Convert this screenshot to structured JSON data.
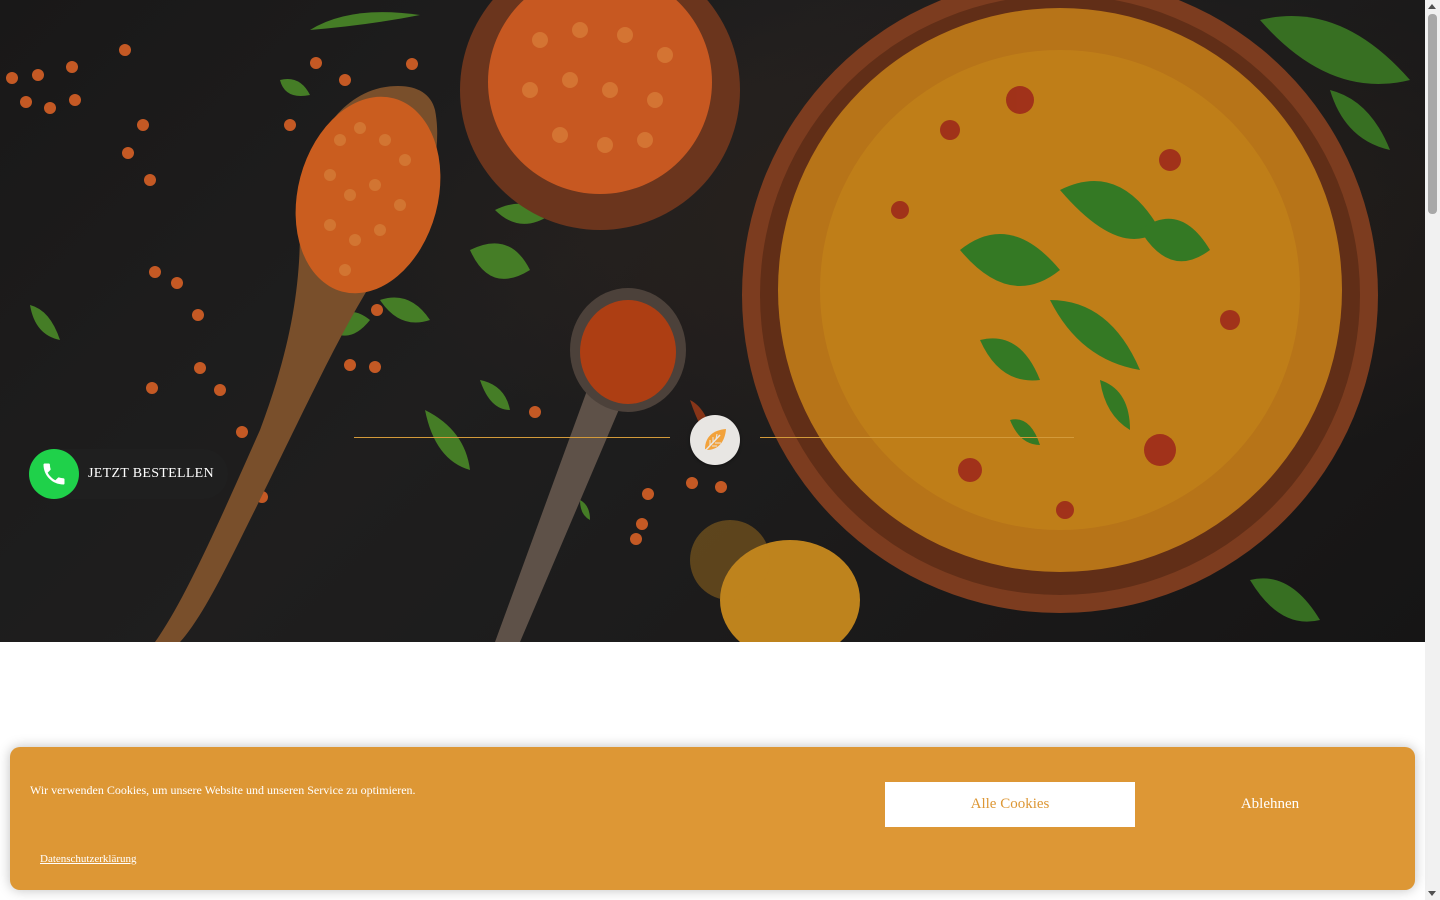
{
  "hero": {
    "image_alt": "Red lentil soup in clay bowl with lentils and spices",
    "leaf_icon": "leaf-icon",
    "accent_color": "#d39a3a"
  },
  "order_button": {
    "label": "JETZT BESTELLEN",
    "icon": "phone-icon",
    "icon_color": "#1fd14a"
  },
  "cookie_banner": {
    "message": "Wir verwenden Cookies, um unsere Website und unseren Service zu optimieren.",
    "accept_label": "Alle Cookies",
    "decline_label": "Ablehnen",
    "privacy_link": "Datenschutzerklärung",
    "background_color": "#dd9735"
  }
}
